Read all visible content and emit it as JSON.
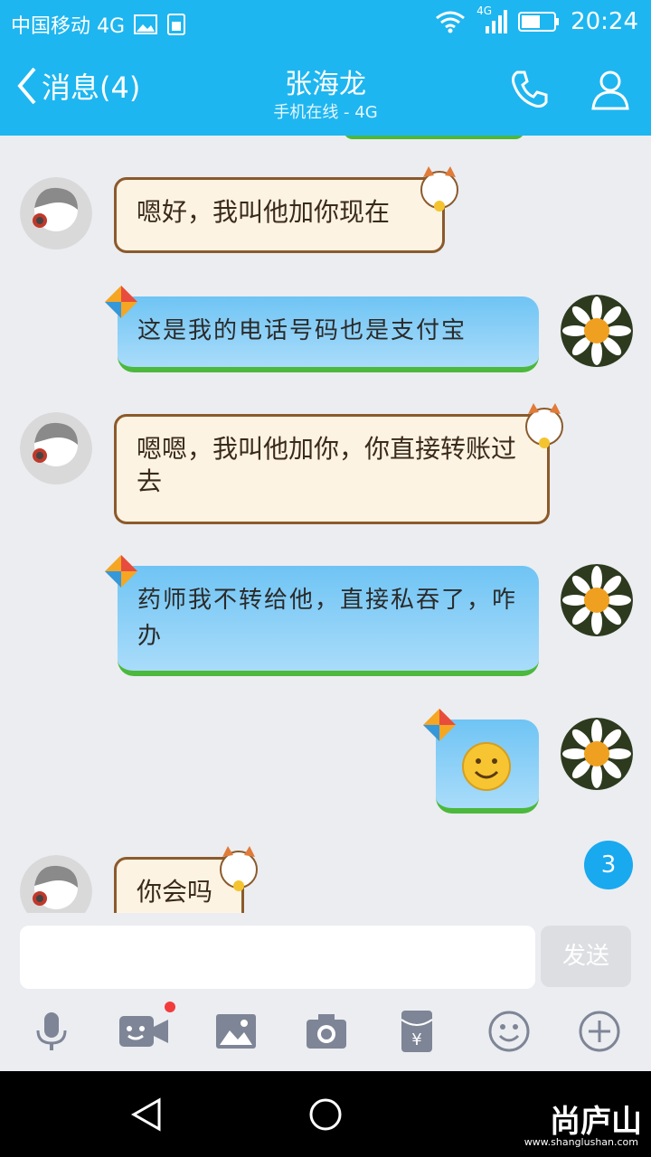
{
  "status": {
    "carrier": "中国移动 4G",
    "net_badge": "4G",
    "time": "20:24"
  },
  "header": {
    "back_label": "消息(4)",
    "title": "张海龙",
    "subtitle": "手机在线 - 4G"
  },
  "messages": [
    {
      "side": "in",
      "text": "嗯好，我叫他加你现在"
    },
    {
      "side": "out",
      "text": "这是我的电话号码也是支付宝"
    },
    {
      "side": "in",
      "text": "嗯嗯，我叫他加你，你直接转账过去"
    },
    {
      "side": "out",
      "text": "药师我不转给他，直接私吞了，咋办"
    },
    {
      "side": "out",
      "text": "",
      "emoji": "smile-emoji"
    },
    {
      "side": "in",
      "text": "你会吗"
    }
  ],
  "unread_count": "3",
  "composer": {
    "placeholder": "",
    "send_label": "发送"
  },
  "toolbar": [
    "mic-icon",
    "video-icon",
    "image-icon",
    "camera-icon",
    "red-packet-icon",
    "emoji-icon",
    "plus-icon"
  ],
  "watermark": {
    "logo": "尚庐山",
    "url": "www.shanglushan.com"
  },
  "colors": {
    "header": "#1eb6f0",
    "badge": "#18a9ef",
    "background": "#ebedf1"
  }
}
